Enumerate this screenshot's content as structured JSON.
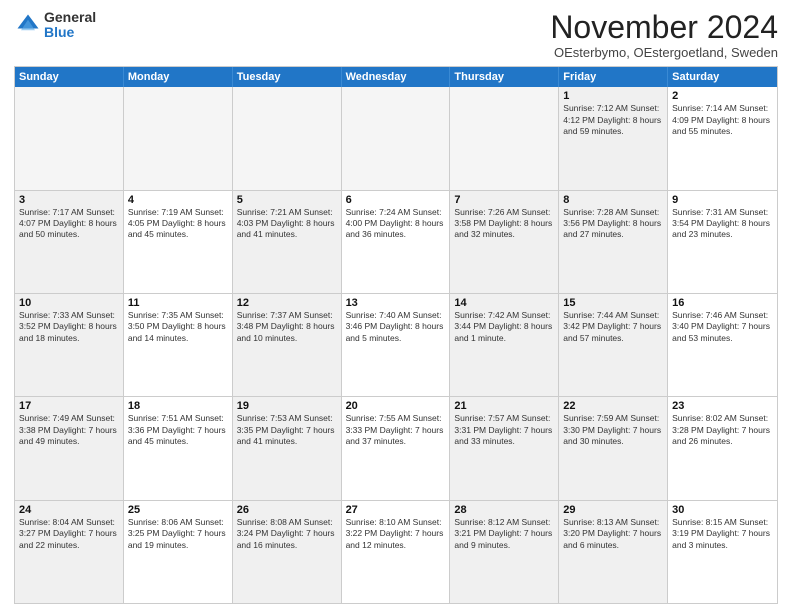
{
  "header": {
    "logo_general": "General",
    "logo_blue": "Blue",
    "month_title": "November 2024",
    "location": "OEsterbymo, OEstergoetland, Sweden"
  },
  "weekdays": [
    "Sunday",
    "Monday",
    "Tuesday",
    "Wednesday",
    "Thursday",
    "Friday",
    "Saturday"
  ],
  "rows": [
    [
      {
        "day": "",
        "info": "",
        "empty": true
      },
      {
        "day": "",
        "info": "",
        "empty": true
      },
      {
        "day": "",
        "info": "",
        "empty": true
      },
      {
        "day": "",
        "info": "",
        "empty": true
      },
      {
        "day": "",
        "info": "",
        "empty": true
      },
      {
        "day": "1",
        "info": "Sunrise: 7:12 AM\nSunset: 4:12 PM\nDaylight: 8 hours\nand 59 minutes.",
        "shaded": true
      },
      {
        "day": "2",
        "info": "Sunrise: 7:14 AM\nSunset: 4:09 PM\nDaylight: 8 hours\nand 55 minutes.",
        "shaded": false
      }
    ],
    [
      {
        "day": "3",
        "info": "Sunrise: 7:17 AM\nSunset: 4:07 PM\nDaylight: 8 hours\nand 50 minutes.",
        "shaded": true
      },
      {
        "day": "4",
        "info": "Sunrise: 7:19 AM\nSunset: 4:05 PM\nDaylight: 8 hours\nand 45 minutes.",
        "shaded": false
      },
      {
        "day": "5",
        "info": "Sunrise: 7:21 AM\nSunset: 4:03 PM\nDaylight: 8 hours\nand 41 minutes.",
        "shaded": true
      },
      {
        "day": "6",
        "info": "Sunrise: 7:24 AM\nSunset: 4:00 PM\nDaylight: 8 hours\nand 36 minutes.",
        "shaded": false
      },
      {
        "day": "7",
        "info": "Sunrise: 7:26 AM\nSunset: 3:58 PM\nDaylight: 8 hours\nand 32 minutes.",
        "shaded": true
      },
      {
        "day": "8",
        "info": "Sunrise: 7:28 AM\nSunset: 3:56 PM\nDaylight: 8 hours\nand 27 minutes.",
        "shaded": true
      },
      {
        "day": "9",
        "info": "Sunrise: 7:31 AM\nSunset: 3:54 PM\nDaylight: 8 hours\nand 23 minutes.",
        "shaded": false
      }
    ],
    [
      {
        "day": "10",
        "info": "Sunrise: 7:33 AM\nSunset: 3:52 PM\nDaylight: 8 hours\nand 18 minutes.",
        "shaded": true
      },
      {
        "day": "11",
        "info": "Sunrise: 7:35 AM\nSunset: 3:50 PM\nDaylight: 8 hours\nand 14 minutes.",
        "shaded": false
      },
      {
        "day": "12",
        "info": "Sunrise: 7:37 AM\nSunset: 3:48 PM\nDaylight: 8 hours\nand 10 minutes.",
        "shaded": true
      },
      {
        "day": "13",
        "info": "Sunrise: 7:40 AM\nSunset: 3:46 PM\nDaylight: 8 hours\nand 5 minutes.",
        "shaded": false
      },
      {
        "day": "14",
        "info": "Sunrise: 7:42 AM\nSunset: 3:44 PM\nDaylight: 8 hours\nand 1 minute.",
        "shaded": true
      },
      {
        "day": "15",
        "info": "Sunrise: 7:44 AM\nSunset: 3:42 PM\nDaylight: 7 hours\nand 57 minutes.",
        "shaded": true
      },
      {
        "day": "16",
        "info": "Sunrise: 7:46 AM\nSunset: 3:40 PM\nDaylight: 7 hours\nand 53 minutes.",
        "shaded": false
      }
    ],
    [
      {
        "day": "17",
        "info": "Sunrise: 7:49 AM\nSunset: 3:38 PM\nDaylight: 7 hours\nand 49 minutes.",
        "shaded": true
      },
      {
        "day": "18",
        "info": "Sunrise: 7:51 AM\nSunset: 3:36 PM\nDaylight: 7 hours\nand 45 minutes.",
        "shaded": false
      },
      {
        "day": "19",
        "info": "Sunrise: 7:53 AM\nSunset: 3:35 PM\nDaylight: 7 hours\nand 41 minutes.",
        "shaded": true
      },
      {
        "day": "20",
        "info": "Sunrise: 7:55 AM\nSunset: 3:33 PM\nDaylight: 7 hours\nand 37 minutes.",
        "shaded": false
      },
      {
        "day": "21",
        "info": "Sunrise: 7:57 AM\nSunset: 3:31 PM\nDaylight: 7 hours\nand 33 minutes.",
        "shaded": true
      },
      {
        "day": "22",
        "info": "Sunrise: 7:59 AM\nSunset: 3:30 PM\nDaylight: 7 hours\nand 30 minutes.",
        "shaded": true
      },
      {
        "day": "23",
        "info": "Sunrise: 8:02 AM\nSunset: 3:28 PM\nDaylight: 7 hours\nand 26 minutes.",
        "shaded": false
      }
    ],
    [
      {
        "day": "24",
        "info": "Sunrise: 8:04 AM\nSunset: 3:27 PM\nDaylight: 7 hours\nand 22 minutes.",
        "shaded": true
      },
      {
        "day": "25",
        "info": "Sunrise: 8:06 AM\nSunset: 3:25 PM\nDaylight: 7 hours\nand 19 minutes.",
        "shaded": false
      },
      {
        "day": "26",
        "info": "Sunrise: 8:08 AM\nSunset: 3:24 PM\nDaylight: 7 hours\nand 16 minutes.",
        "shaded": true
      },
      {
        "day": "27",
        "info": "Sunrise: 8:10 AM\nSunset: 3:22 PM\nDaylight: 7 hours\nand 12 minutes.",
        "shaded": false
      },
      {
        "day": "28",
        "info": "Sunrise: 8:12 AM\nSunset: 3:21 PM\nDaylight: 7 hours\nand 9 minutes.",
        "shaded": true
      },
      {
        "day": "29",
        "info": "Sunrise: 8:13 AM\nSunset: 3:20 PM\nDaylight: 7 hours\nand 6 minutes.",
        "shaded": true
      },
      {
        "day": "30",
        "info": "Sunrise: 8:15 AM\nSunset: 3:19 PM\nDaylight: 7 hours\nand 3 minutes.",
        "shaded": false
      }
    ]
  ]
}
